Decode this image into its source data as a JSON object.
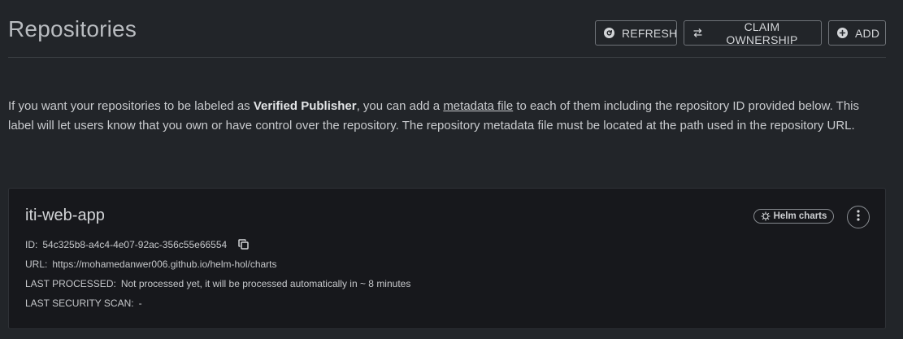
{
  "page": {
    "title": "Repositories"
  },
  "actions": {
    "refresh_label": "REFRESH",
    "claim_label": "CLAIM OWNERSHIP",
    "add_label": "ADD"
  },
  "intro": {
    "part1": "If you want your repositories to be labeled as ",
    "verified": "Verified Publisher",
    "part2": ", you can add a ",
    "link": "metadata file",
    "part3": " to each of them including the repository ID provided below. This label will let users know that you own or have control over the repository. The repository metadata file must be located at the path used in the repository URL."
  },
  "repository": {
    "name": "iti-web-app",
    "kind": "Helm charts",
    "id_label": "ID:",
    "id": "54c325b8-a4c4-4e07-92ac-356c55e66554",
    "url_label": "URL:",
    "url": "https://mohamedanwer006.github.io/helm-hol/charts",
    "processed_label": "LAST PROCESSED:",
    "processed": "Not processed yet, it will be processed automatically in ~ 8 minutes",
    "scan_label": "LAST SECURITY SCAN:",
    "scan": "-"
  },
  "colors": {
    "background": "#222529",
    "card": "#17181c",
    "text": "#c9cbce"
  },
  "icons": [
    "refresh-icon",
    "swap-icon",
    "plus-circle-icon",
    "helm-icon",
    "copy-icon",
    "more-vertical-icon"
  ]
}
